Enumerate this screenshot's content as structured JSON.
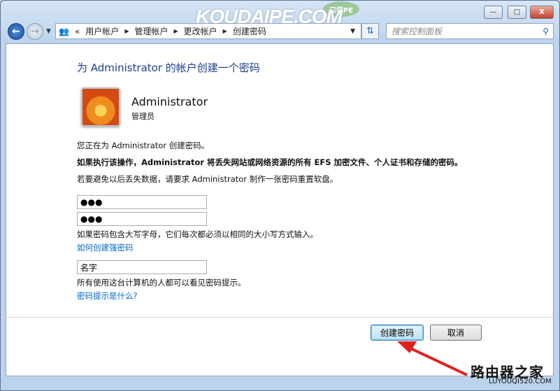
{
  "window": {
    "minimize": "—",
    "maximize": "□",
    "close": "X",
    "watermark": "KOUDAIPE.COM",
    "watermark_badge": "口袋PE"
  },
  "nav": {
    "breadcrumb_prefix": "«",
    "breadcrumb": [
      "用户帐户",
      "管理帐户",
      "更改帐户",
      "创建密码"
    ],
    "search_placeholder": "搜索控制面板"
  },
  "page": {
    "title": "为 Administrator 的帐户创建一个密码",
    "user_name": "Administrator",
    "user_role": "管理员",
    "line1": "您正在为 Administrator 创建密码。",
    "line2": "如果执行该操作，Administrator 将丢失网站或网络资源的所有 EFS 加密文件、个人证书和存储的密码。",
    "line3": "若要避免以后丢失数据，请要求 Administrator 制作一张密码重置软盘。",
    "password": "●●●",
    "confirm_password": "●●●",
    "case_note": "如果密码包含大写字母，它们每次都必须以相同的大小写方式输入。",
    "strong_link": "如何创建强密码",
    "hint_value": "名字",
    "hint_note": "所有使用这台计算机的人都可以看见密码提示。",
    "hint_link": "密码提示是什么?"
  },
  "buttons": {
    "create": "创建密码",
    "cancel": "取消"
  },
  "footer_watermark": {
    "name": "路由器之家",
    "url": "LUYOUQI520.COM"
  }
}
